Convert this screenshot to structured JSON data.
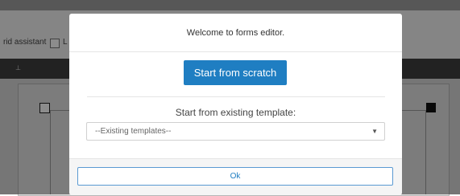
{
  "background": {
    "grid_assistant_label": "rid assistant",
    "extra_label": "L"
  },
  "modal": {
    "title": "Welcome to forms editor.",
    "start_scratch_label": "Start from scratch",
    "existing_template_label": "Start from existing template:",
    "template_select": {
      "selected": "--Existing templates--"
    },
    "ok_label": "Ok"
  },
  "colors": {
    "primary": "#1f7ec2",
    "overlay": "rgba(0,0,0,0.45)"
  },
  "icons": {
    "select_arrow": "chevron-down-icon"
  }
}
